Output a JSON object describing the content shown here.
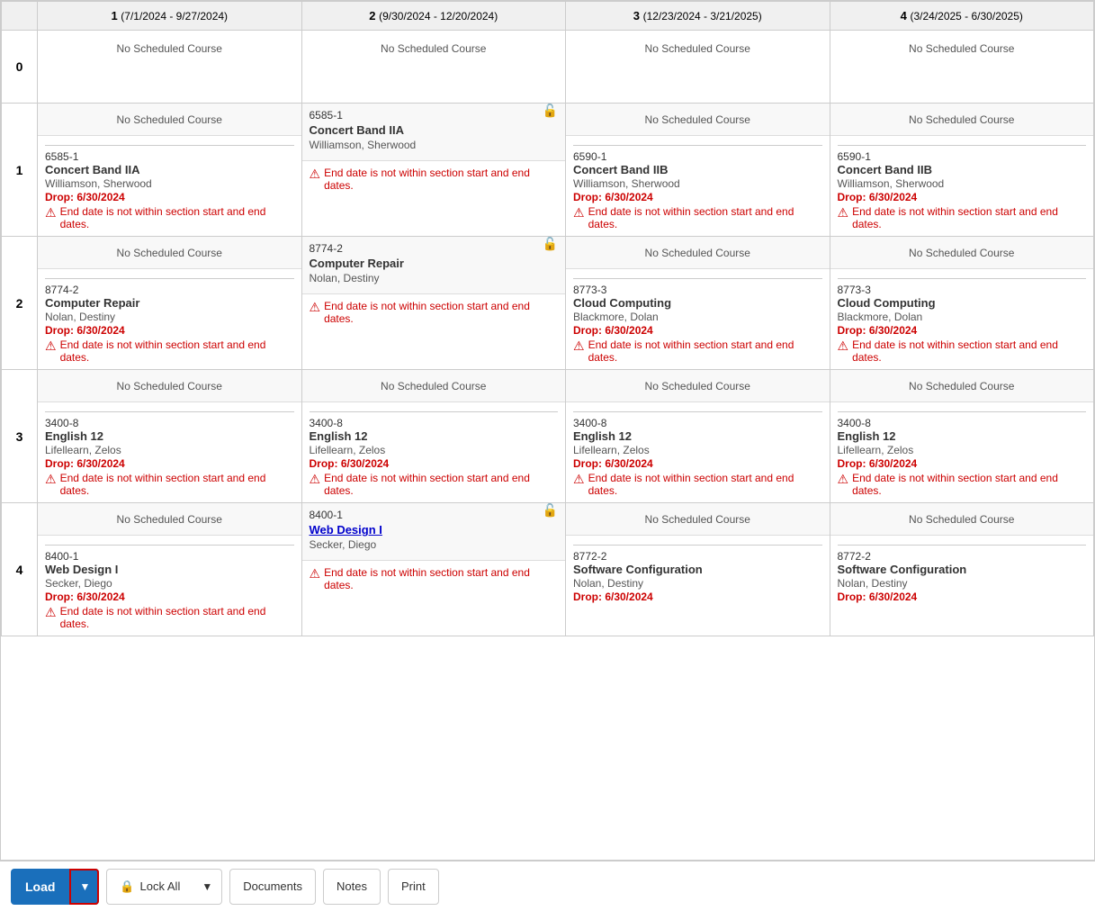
{
  "header": {
    "col0": "",
    "col1_label": "1",
    "col1_dates": "(7/1/2024 - 9/27/2024)",
    "col2_label": "2",
    "col2_dates": "(9/30/2024 - 12/20/2024)",
    "col3_label": "3",
    "col3_dates": "(12/23/2024 - 3/21/2025)",
    "col4_label": "4",
    "col4_dates": "(3/24/2025 - 6/30/2025)"
  },
  "rows": [
    {
      "rowNum": "0",
      "cells": [
        {
          "top": "No Scheduled Course",
          "hasContent": false
        },
        {
          "top": "No Scheduled Course",
          "hasContent": false
        },
        {
          "top": "No Scheduled Course",
          "hasContent": false
        },
        {
          "top": "No Scheduled Course",
          "hasContent": false
        }
      ]
    },
    {
      "rowNum": "1",
      "cells": [
        {
          "top": "No Scheduled Course",
          "hasContent": true,
          "locked": false,
          "courseNum": "6585-1",
          "courseName": "Concert Band IIA",
          "teacher": "Williamson, Sherwood",
          "dropDate": "Drop: 6/30/2024",
          "errorMsg": "End date is not within section start and end dates."
        },
        {
          "top": "6585-1",
          "topBold": "Concert Band IIA",
          "topTeacher": "Williamson, Sherwood",
          "hasContent": true,
          "locked": true,
          "errorMsg": "End date is not within section start and end dates.",
          "isTopContent": true
        },
        {
          "top": "No Scheduled Course",
          "hasContent": true,
          "locked": false,
          "courseNum": "6590-1",
          "courseName": "Concert Band IIB",
          "teacher": "Williamson, Sherwood",
          "dropDate": "Drop: 6/30/2024",
          "errorMsg": "End date is not within section start and end dates."
        },
        {
          "top": "No Scheduled Course",
          "hasContent": true,
          "locked": false,
          "courseNum": "6590-1",
          "courseName": "Concert Band IIB",
          "teacher": "Williamson, Sherwood",
          "dropDate": "Drop: 6/30/2024",
          "errorMsg": "End date is not within section start and end dates."
        }
      ]
    },
    {
      "rowNum": "2",
      "cells": [
        {
          "top": "No Scheduled Course",
          "hasContent": true,
          "locked": false,
          "courseNum": "8774-2",
          "courseName": "Computer Repair",
          "teacher": "Nolan, Destiny",
          "dropDate": "Drop: 6/30/2024",
          "errorMsg": "End date is not within section start and end dates."
        },
        {
          "top": "8774-2",
          "topBold": "Computer Repair",
          "topTeacher": "Nolan, Destiny",
          "hasContent": true,
          "locked": true,
          "errorMsg": "End date is not within section start and end dates.",
          "isTopContent": true
        },
        {
          "top": "No Scheduled Course",
          "hasContent": true,
          "locked": false,
          "courseNum": "8773-3",
          "courseName": "Cloud Computing",
          "teacher": "Blackmore, Dolan",
          "dropDate": "Drop: 6/30/2024",
          "errorMsg": "End date is not within section start and end dates."
        },
        {
          "top": "No Scheduled Course",
          "hasContent": true,
          "locked": false,
          "courseNum": "8773-3",
          "courseName": "Cloud Computing",
          "teacher": "Blackmore, Dolan",
          "dropDate": "Drop: 6/30/2024",
          "errorMsg": "End date is not within section start and end dates."
        }
      ]
    },
    {
      "rowNum": "3",
      "cells": [
        {
          "top": "No Scheduled Course",
          "hasContent": true,
          "locked": false,
          "courseNum": "3400-8",
          "courseName": "English 12",
          "teacher": "Lifellearn, Zelos",
          "dropDate": "Drop: 6/30/2024",
          "errorMsg": "End date is not within section start and end dates."
        },
        {
          "top": "No Scheduled Course",
          "hasContent": true,
          "locked": false,
          "courseNum": "3400-8",
          "courseName": "English 12",
          "teacher": "Lifellearn, Zelos",
          "dropDate": "Drop: 6/30/2024",
          "errorMsg": "End date is not within section start and end dates."
        },
        {
          "top": "No Scheduled Course",
          "hasContent": true,
          "locked": false,
          "courseNum": "3400-8",
          "courseName": "English 12",
          "teacher": "Lifellearn, Zelos",
          "dropDate": "Drop: 6/30/2024",
          "errorMsg": "End date is not within section start and end dates."
        },
        {
          "top": "No Scheduled Course",
          "hasContent": true,
          "locked": false,
          "courseNum": "3400-8",
          "courseName": "English 12",
          "teacher": "Lifellearn, Zelos",
          "dropDate": "Drop: 6/30/2024",
          "errorMsg": "End date is not within section start and end dates."
        }
      ]
    },
    {
      "rowNum": "4",
      "cells": [
        {
          "top": "No Scheduled Course",
          "hasContent": true,
          "locked": false,
          "courseNum": "8400-1",
          "courseName": "Web Design I",
          "teacher": "Secker, Diego",
          "dropDate": "Drop: 6/30/2024",
          "errorMsg": "End date is not within section start and end dates.",
          "partial": true
        },
        {
          "top": "8400-1",
          "topBold": "Web Design I",
          "topBoldBlue": true,
          "topTeacher": "Secker, Diego",
          "hasContent": true,
          "locked": true,
          "errorMsg": "End date is not within section start and end dates.",
          "isTopContent": true
        },
        {
          "top": "No Scheduled Course",
          "hasContent": true,
          "locked": false,
          "courseNum": "8772-2",
          "courseName": "Software Configuration",
          "teacher": "Nolan, Destiny",
          "dropDate": "Drop: 6/30/2024",
          "partial": true
        },
        {
          "top": "No Scheduled Course",
          "hasContent": true,
          "locked": false,
          "courseNum": "8772-2",
          "courseName": "Software Configuration",
          "teacher": "Nolan, Destiny",
          "dropDate": "Drop: 6/30/2024",
          "partial": true
        }
      ]
    }
  ],
  "toolbar": {
    "load_label": "Load",
    "load_arrow": "▼",
    "lock_all_label": "Lock All",
    "lock_icon": "🔒",
    "lock_arrow": "▼",
    "documents_label": "Documents",
    "notes_label": "Notes",
    "print_label": "Print"
  }
}
